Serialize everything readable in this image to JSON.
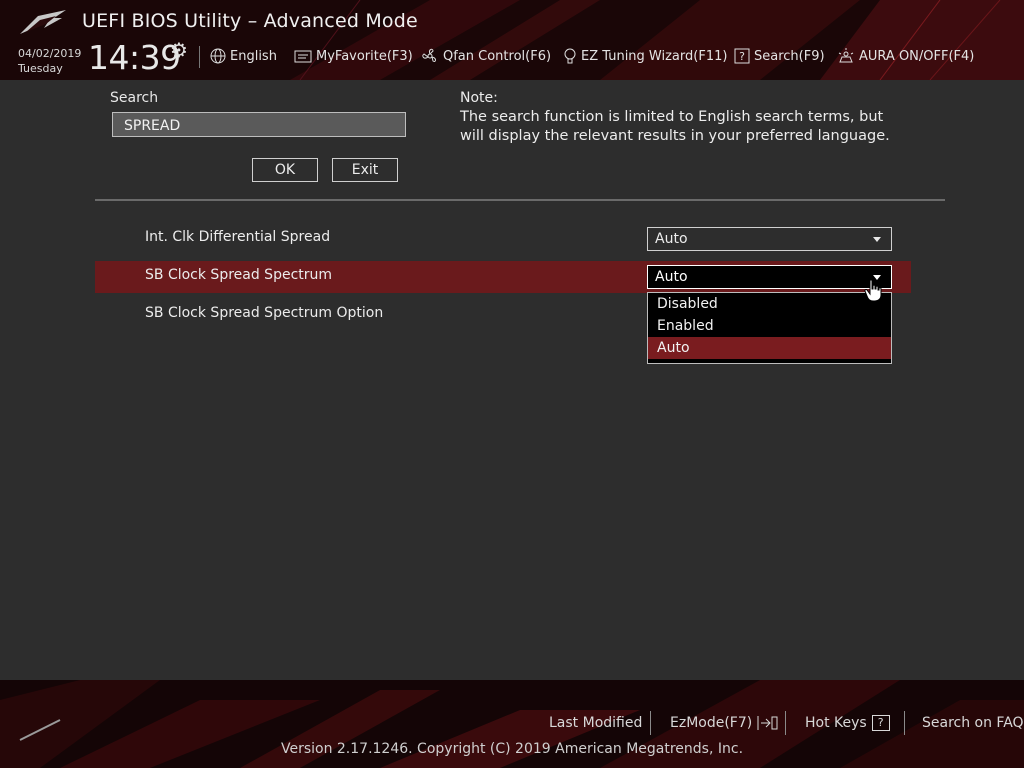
{
  "app": {
    "title": "UEFI BIOS Utility – Advanced Mode"
  },
  "header": {
    "date": "04/02/2019",
    "day": "Tuesday",
    "time": "14:39",
    "items": [
      {
        "label": "English",
        "icon": "globe-icon"
      },
      {
        "label": "MyFavorite(F3)",
        "icon": "favorite-icon"
      },
      {
        "label": "Qfan Control(F6)",
        "icon": "fan-icon"
      },
      {
        "label": "EZ Tuning Wizard(F11)",
        "icon": "lightbulb-icon"
      },
      {
        "label": "Search(F9)",
        "icon": "question-icon"
      },
      {
        "label": "AURA ON/OFF(F4)",
        "icon": "aura-icon"
      }
    ]
  },
  "search": {
    "label": "Search",
    "value": "SPREAD",
    "ok_label": "OK",
    "exit_label": "Exit"
  },
  "note": {
    "title": "Note:",
    "text": "The search function is limited to English search terms, but will display the relevant results in your preferred language."
  },
  "results": [
    {
      "label": "Int. Clk Differential Spread",
      "value": "Auto"
    },
    {
      "label": "SB Clock Spread Spectrum",
      "value": "Auto"
    },
    {
      "label": "SB Clock Spread Spectrum Option",
      "value": ""
    }
  ],
  "dropdown": {
    "options": [
      "Disabled",
      "Enabled",
      "Auto"
    ],
    "selected": "Auto"
  },
  "footer": {
    "last_modified": "Last Modified",
    "ezmode": "EzMode(F7)",
    "hot_keys": "Hot Keys",
    "hot_keys_key": "?",
    "search_faq": "Search on FAQ",
    "version": "Version 2.17.1246. Copyright (C) 2019 American Megatrends, Inc."
  },
  "colors": {
    "accent": "#7a1c1f",
    "highlight_row": "#6a1a1c",
    "background": "#2d2d2d"
  }
}
